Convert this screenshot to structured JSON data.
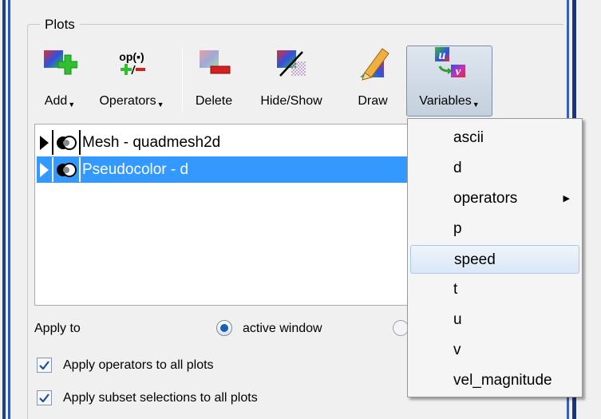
{
  "group_title": "Plots",
  "toolbar": {
    "add": "Add",
    "operators": "Operators",
    "delete": "Delete",
    "hide_show": "Hide/Show",
    "draw": "Draw",
    "variables": "Variables",
    "operators_icon_text": "op(▪)"
  },
  "plots": [
    {
      "label": "Mesh - quadmesh2d",
      "selected": false
    },
    {
      "label": "Pseudocolor - d",
      "selected": true
    }
  ],
  "apply_to": {
    "label": "Apply to",
    "active_window_label": "active window",
    "active_window_selected": true
  },
  "checks": {
    "operators_label": "Apply operators to all plots",
    "operators_checked": true,
    "subset_label": "Apply subset selections to all plots",
    "subset_checked": true
  },
  "variables_menu": {
    "items": [
      "ascii",
      "d",
      "operators",
      "p",
      "speed",
      "t",
      "u",
      "v",
      "vel_magnitude"
    ],
    "highlighted": "speed",
    "submenu_item": "operators"
  },
  "colors": {
    "selection": "#3399ff",
    "add_green": "#2fbf2f",
    "delete_red": "#d42020"
  }
}
